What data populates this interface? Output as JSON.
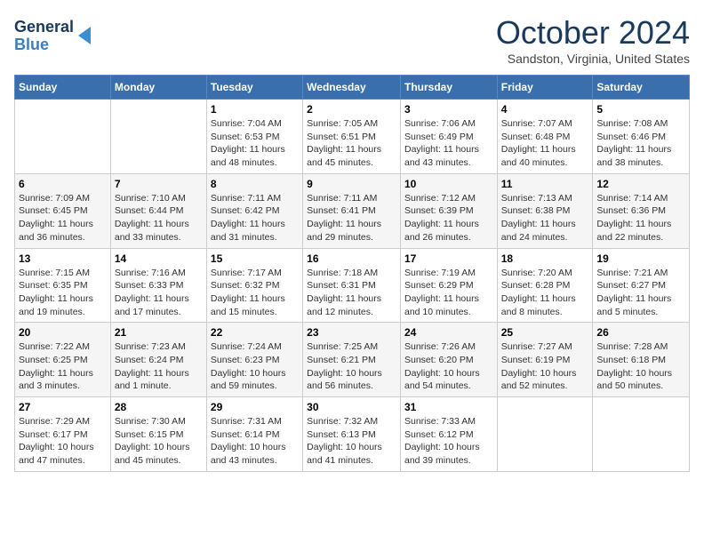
{
  "header": {
    "logo_line1": "General",
    "logo_line2": "Blue",
    "month_title": "October 2024",
    "location": "Sandston, Virginia, United States"
  },
  "weekdays": [
    "Sunday",
    "Monday",
    "Tuesday",
    "Wednesday",
    "Thursday",
    "Friday",
    "Saturday"
  ],
  "weeks": [
    [
      {
        "day": "",
        "info": ""
      },
      {
        "day": "",
        "info": ""
      },
      {
        "day": "1",
        "info": "Sunrise: 7:04 AM\nSunset: 6:53 PM\nDaylight: 11 hours and 48 minutes."
      },
      {
        "day": "2",
        "info": "Sunrise: 7:05 AM\nSunset: 6:51 PM\nDaylight: 11 hours and 45 minutes."
      },
      {
        "day": "3",
        "info": "Sunrise: 7:06 AM\nSunset: 6:49 PM\nDaylight: 11 hours and 43 minutes."
      },
      {
        "day": "4",
        "info": "Sunrise: 7:07 AM\nSunset: 6:48 PM\nDaylight: 11 hours and 40 minutes."
      },
      {
        "day": "5",
        "info": "Sunrise: 7:08 AM\nSunset: 6:46 PM\nDaylight: 11 hours and 38 minutes."
      }
    ],
    [
      {
        "day": "6",
        "info": "Sunrise: 7:09 AM\nSunset: 6:45 PM\nDaylight: 11 hours and 36 minutes."
      },
      {
        "day": "7",
        "info": "Sunrise: 7:10 AM\nSunset: 6:44 PM\nDaylight: 11 hours and 33 minutes."
      },
      {
        "day": "8",
        "info": "Sunrise: 7:11 AM\nSunset: 6:42 PM\nDaylight: 11 hours and 31 minutes."
      },
      {
        "day": "9",
        "info": "Sunrise: 7:11 AM\nSunset: 6:41 PM\nDaylight: 11 hours and 29 minutes."
      },
      {
        "day": "10",
        "info": "Sunrise: 7:12 AM\nSunset: 6:39 PM\nDaylight: 11 hours and 26 minutes."
      },
      {
        "day": "11",
        "info": "Sunrise: 7:13 AM\nSunset: 6:38 PM\nDaylight: 11 hours and 24 minutes."
      },
      {
        "day": "12",
        "info": "Sunrise: 7:14 AM\nSunset: 6:36 PM\nDaylight: 11 hours and 22 minutes."
      }
    ],
    [
      {
        "day": "13",
        "info": "Sunrise: 7:15 AM\nSunset: 6:35 PM\nDaylight: 11 hours and 19 minutes."
      },
      {
        "day": "14",
        "info": "Sunrise: 7:16 AM\nSunset: 6:33 PM\nDaylight: 11 hours and 17 minutes."
      },
      {
        "day": "15",
        "info": "Sunrise: 7:17 AM\nSunset: 6:32 PM\nDaylight: 11 hours and 15 minutes."
      },
      {
        "day": "16",
        "info": "Sunrise: 7:18 AM\nSunset: 6:31 PM\nDaylight: 11 hours and 12 minutes."
      },
      {
        "day": "17",
        "info": "Sunrise: 7:19 AM\nSunset: 6:29 PM\nDaylight: 11 hours and 10 minutes."
      },
      {
        "day": "18",
        "info": "Sunrise: 7:20 AM\nSunset: 6:28 PM\nDaylight: 11 hours and 8 minutes."
      },
      {
        "day": "19",
        "info": "Sunrise: 7:21 AM\nSunset: 6:27 PM\nDaylight: 11 hours and 5 minutes."
      }
    ],
    [
      {
        "day": "20",
        "info": "Sunrise: 7:22 AM\nSunset: 6:25 PM\nDaylight: 11 hours and 3 minutes."
      },
      {
        "day": "21",
        "info": "Sunrise: 7:23 AM\nSunset: 6:24 PM\nDaylight: 11 hours and 1 minute."
      },
      {
        "day": "22",
        "info": "Sunrise: 7:24 AM\nSunset: 6:23 PM\nDaylight: 10 hours and 59 minutes."
      },
      {
        "day": "23",
        "info": "Sunrise: 7:25 AM\nSunset: 6:21 PM\nDaylight: 10 hours and 56 minutes."
      },
      {
        "day": "24",
        "info": "Sunrise: 7:26 AM\nSunset: 6:20 PM\nDaylight: 10 hours and 54 minutes."
      },
      {
        "day": "25",
        "info": "Sunrise: 7:27 AM\nSunset: 6:19 PM\nDaylight: 10 hours and 52 minutes."
      },
      {
        "day": "26",
        "info": "Sunrise: 7:28 AM\nSunset: 6:18 PM\nDaylight: 10 hours and 50 minutes."
      }
    ],
    [
      {
        "day": "27",
        "info": "Sunrise: 7:29 AM\nSunset: 6:17 PM\nDaylight: 10 hours and 47 minutes."
      },
      {
        "day": "28",
        "info": "Sunrise: 7:30 AM\nSunset: 6:15 PM\nDaylight: 10 hours and 45 minutes."
      },
      {
        "day": "29",
        "info": "Sunrise: 7:31 AM\nSunset: 6:14 PM\nDaylight: 10 hours and 43 minutes."
      },
      {
        "day": "30",
        "info": "Sunrise: 7:32 AM\nSunset: 6:13 PM\nDaylight: 10 hours and 41 minutes."
      },
      {
        "day": "31",
        "info": "Sunrise: 7:33 AM\nSunset: 6:12 PM\nDaylight: 10 hours and 39 minutes."
      },
      {
        "day": "",
        "info": ""
      },
      {
        "day": "",
        "info": ""
      }
    ]
  ]
}
